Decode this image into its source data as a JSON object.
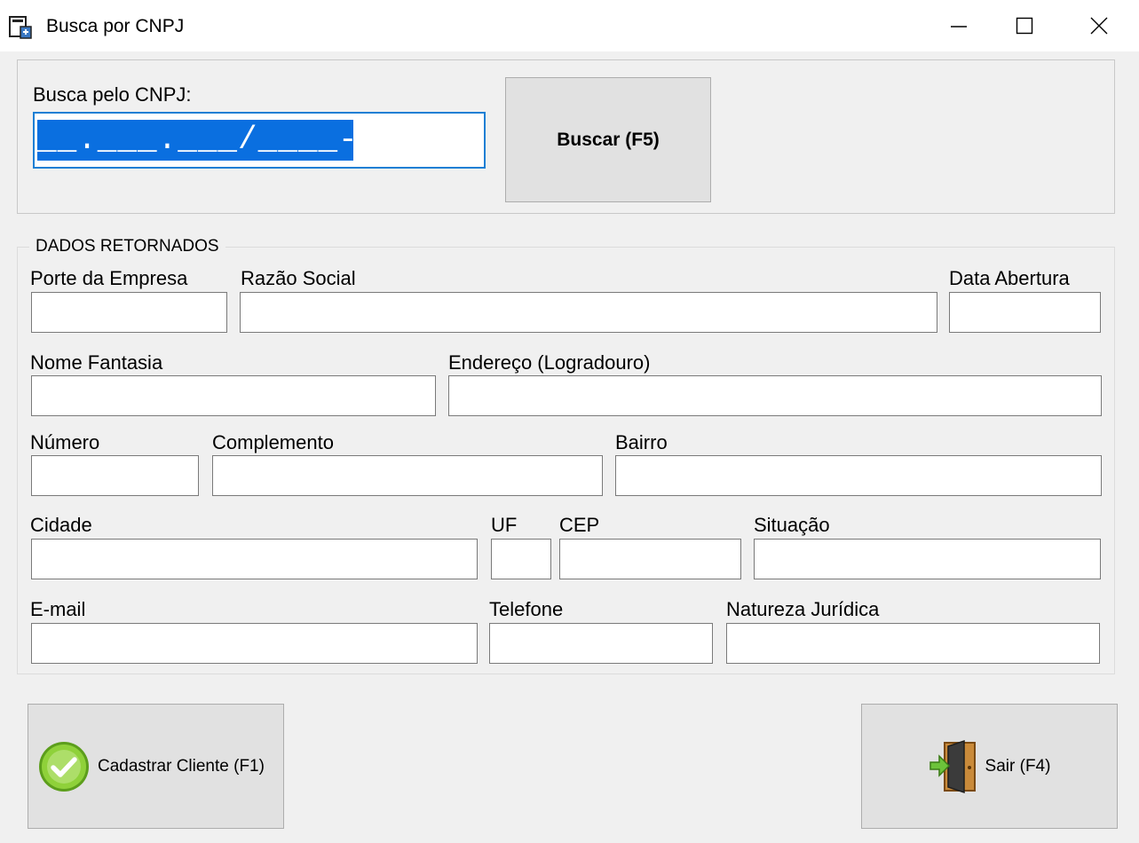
{
  "window": {
    "title": "Busca por CNPJ",
    "icon": "document-window-icon",
    "controls": [
      "minimize-icon",
      "maximize-icon",
      "close-icon"
    ]
  },
  "search": {
    "label": "Busca pelo CNPJ:",
    "mask_value": "__.___.___/____-__",
    "button": "Buscar (F5)"
  },
  "data_group": {
    "legend": "DADOS RETORNADOS",
    "fields": {
      "porte": "Porte da Empresa",
      "razao": "Razão Social",
      "data_abertura": "Data Abertura",
      "nome_fantasia": "Nome Fantasia",
      "endereco": "Endereço (Logradouro)",
      "numero": "Número",
      "complemento": "Complemento",
      "bairro": "Bairro",
      "cidade": "Cidade",
      "uf": "UF",
      "cep": "CEP",
      "situacao": "Situação",
      "email": "E-mail",
      "telefone": "Telefone",
      "natureza": "Natureza Jurídica"
    }
  },
  "actions": {
    "cadastrar": "Cadastrar Cliente (F1)",
    "sair": "Sair (F4)"
  },
  "colors": {
    "selection": "#0a6fe0",
    "focus_border": "#1a7fd4",
    "button_face": "#e1e1e1",
    "check_green": "#7cc12a"
  }
}
